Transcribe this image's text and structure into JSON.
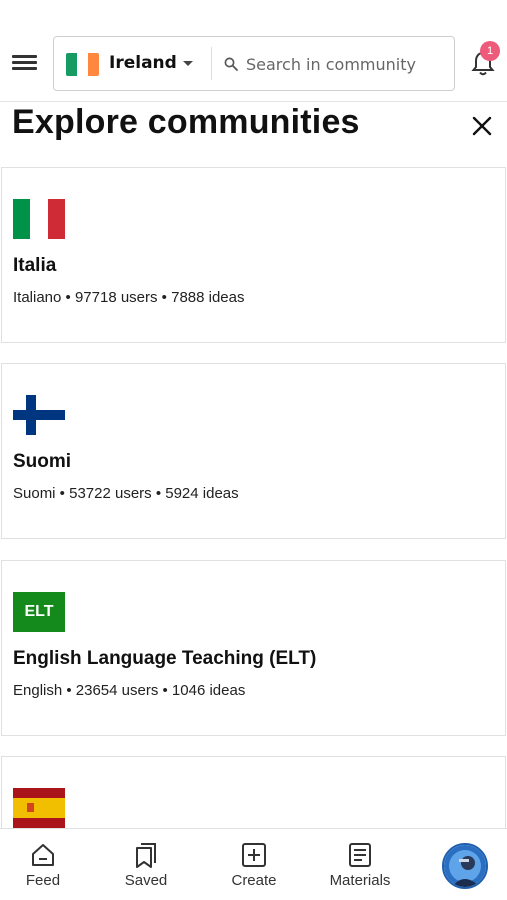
{
  "header": {
    "country": "Ireland",
    "search_placeholder": "Search in community",
    "notification_count": "1"
  },
  "page": {
    "title": "Explore communities"
  },
  "communities": [
    {
      "name": "Italia",
      "meta": "Italiano • 97718 users • 7888 ideas",
      "flag": "italy-flag"
    },
    {
      "name": "Suomi",
      "meta": "Suomi • 53722 users • 5924 ideas",
      "flag": "finland-flag"
    },
    {
      "name": "English Language Teaching (ELT)",
      "meta": "English • 23654 users • 1046 ideas",
      "flag": "elt-badge",
      "badge_text": "ELT"
    },
    {
      "name": "",
      "meta": "",
      "flag": "spain-flag"
    }
  ],
  "bottom_nav": {
    "feed": "Feed",
    "saved": "Saved",
    "create": "Create",
    "materials": "Materials"
  },
  "colors": {
    "badge": "#ee5b7a",
    "elt_green": "#148a1c",
    "ireland": [
      "#169b62",
      "#ffffff",
      "#ff883e"
    ],
    "italy": [
      "#009246",
      "#ffffff",
      "#ce2b37"
    ],
    "finland_blue": "#003580",
    "spain": [
      "#aa151b",
      "#f1bf00"
    ]
  }
}
